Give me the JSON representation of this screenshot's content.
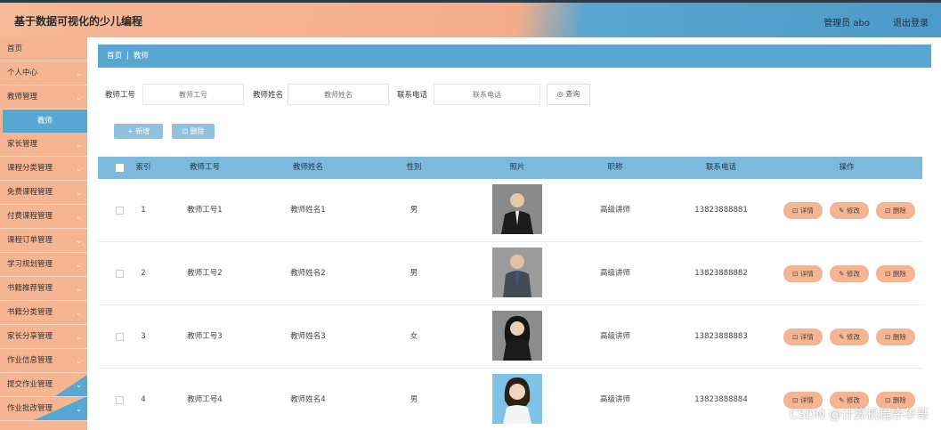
{
  "header": {
    "title": "基于数据可视化的少儿编程",
    "user": "管理员 abo",
    "logout": "退出登录"
  },
  "sidebar": {
    "items": [
      {
        "label": "首页",
        "chevron": false
      },
      {
        "label": "个人中心",
        "chevron": true
      },
      {
        "label": "教师管理",
        "chevron": true
      },
      {
        "label": "家长管理",
        "chevron": true
      },
      {
        "label": "课程分类管理",
        "chevron": true
      },
      {
        "label": "免费课程管理",
        "chevron": true
      },
      {
        "label": "付费课程管理",
        "chevron": true
      },
      {
        "label": "课程订单管理",
        "chevron": true
      },
      {
        "label": "学习规划管理",
        "chevron": true
      },
      {
        "label": "书籍推荐管理",
        "chevron": true
      },
      {
        "label": "书籍分类管理",
        "chevron": true
      },
      {
        "label": "家长分享管理",
        "chevron": true
      },
      {
        "label": "作业信息管理",
        "chevron": true
      },
      {
        "label": "提交作业管理",
        "chevron": true
      },
      {
        "label": "作业批改管理",
        "chevron": true
      }
    ],
    "submenu_label": "教师"
  },
  "breadcrumb": {
    "home": "首页",
    "separator": "|",
    "current": "教师"
  },
  "search": {
    "teacher_no_label": "教师工号",
    "teacher_no_placeholder": "教师工号",
    "teacher_name_label": "教师姓名",
    "teacher_name_placeholder": "教师姓名",
    "phone_label": "联系电话",
    "phone_placeholder": "联系电话",
    "query_label": "◎ 查询"
  },
  "actions": {
    "add_label": "+ 新增",
    "delete_label": "⊡ 删除"
  },
  "table": {
    "headers": [
      "索引",
      "教师工号",
      "教师姓名",
      "性别",
      "照片",
      "职称",
      "联系电话",
      "操作"
    ],
    "rows": [
      {
        "index": "1",
        "no": "教师工号1",
        "name": "教师姓名1",
        "gender": "男",
        "title": "高级讲师",
        "phone": "13823888881"
      },
      {
        "index": "2",
        "no": "教师工号2",
        "name": "教师姓名2",
        "gender": "男",
        "title": "高级讲师",
        "phone": "13823888882"
      },
      {
        "index": "3",
        "no": "教师工号3",
        "name": "教师姓名3",
        "gender": "女",
        "title": "高级讲师",
        "phone": "13823888883"
      },
      {
        "index": "4",
        "no": "教师工号4",
        "name": "教师姓名4",
        "gender": "男",
        "title": "高级讲师",
        "phone": "13823888884"
      }
    ],
    "detail_label": "⊡ 详情",
    "edit_label": "✎ 修改",
    "remove_label": "⊡ 删除"
  },
  "watermark": "CSDN @计算机程序华哥",
  "colors": {
    "accent_orange": "#f6b592",
    "accent_blue": "#58a7d2",
    "table_header": "#7db9dc"
  },
  "icons": [
    "chevron-down-icon",
    "checkbox-icon",
    "detail-icon",
    "edit-icon",
    "delete-icon",
    "search-icon",
    "plus-icon",
    "person-photo-icon"
  ]
}
